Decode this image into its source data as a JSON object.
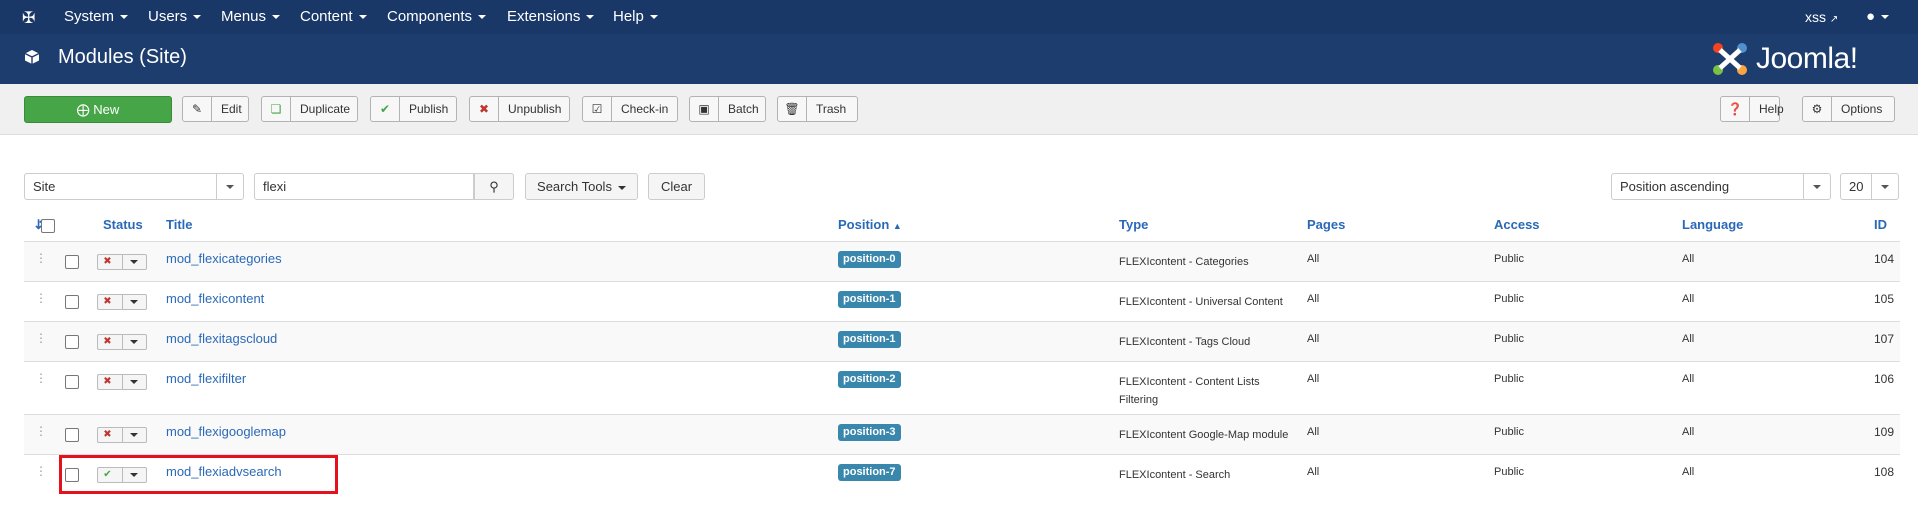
{
  "topnav": {
    "menus": [
      "System",
      "Users",
      "Menus",
      "Content",
      "Components",
      "Extensions",
      "Help"
    ],
    "user_link": "xss"
  },
  "titlebar": {
    "page_title": "Modules (Site)",
    "brand": "Joomla!"
  },
  "toolbar": {
    "new": "New",
    "edit": "Edit",
    "duplicate": "Duplicate",
    "publish": "Publish",
    "unpublish": "Unpublish",
    "checkin": "Check-in",
    "batch": "Batch",
    "trash": "Trash",
    "help": "Help",
    "options": "Options"
  },
  "filters": {
    "client": "Site",
    "search_value": "flexi",
    "search_tools": "Search Tools",
    "clear": "Clear",
    "ordering": "Position ascending",
    "limit": "20"
  },
  "table": {
    "headers": {
      "status": "Status",
      "title": "Title",
      "position": "Position",
      "type": "Type",
      "pages": "Pages",
      "access": "Access",
      "language": "Language",
      "id": "ID"
    },
    "rows": [
      {
        "title": "mod_flexicategories",
        "position": "position-0",
        "type": "FLEXIcontent - Categories",
        "type2": "",
        "pages": "All",
        "access": "Public",
        "language": "All",
        "id": "104",
        "published": false
      },
      {
        "title": "mod_flexicontent",
        "position": "position-1",
        "type": "FLEXIcontent - Universal Content",
        "type2": "",
        "pages": "All",
        "access": "Public",
        "language": "All",
        "id": "105",
        "published": false
      },
      {
        "title": "mod_flexitagscloud",
        "position": "position-1",
        "type": "FLEXIcontent - Tags Cloud",
        "type2": "",
        "pages": "All",
        "access": "Public",
        "language": "All",
        "id": "107",
        "published": false
      },
      {
        "title": "mod_flexifilter",
        "position": "position-2",
        "type": "FLEXIcontent - Content Lists",
        "type2": "Filtering",
        "pages": "All",
        "access": "Public",
        "language": "All",
        "id": "106",
        "published": false
      },
      {
        "title": "mod_flexigooglemap",
        "position": "position-3",
        "type": "FLEXIcontent Google-Map module",
        "type2": "",
        "pages": "All",
        "access": "Public",
        "language": "All",
        "id": "109",
        "published": false
      },
      {
        "title": "mod_flexiadvsearch",
        "position": "position-7",
        "type": "FLEXIcontent - Search",
        "type2": "",
        "pages": "All",
        "access": "Public",
        "language": "All",
        "id": "108",
        "published": true
      }
    ]
  },
  "colors": {
    "nav_bg": "#1a3867",
    "title_bg": "#1c3d6e",
    "new_btn": "#46a546",
    "link": "#2a69b8",
    "badge": "#3a87ad",
    "highlight": "#e5111c"
  }
}
